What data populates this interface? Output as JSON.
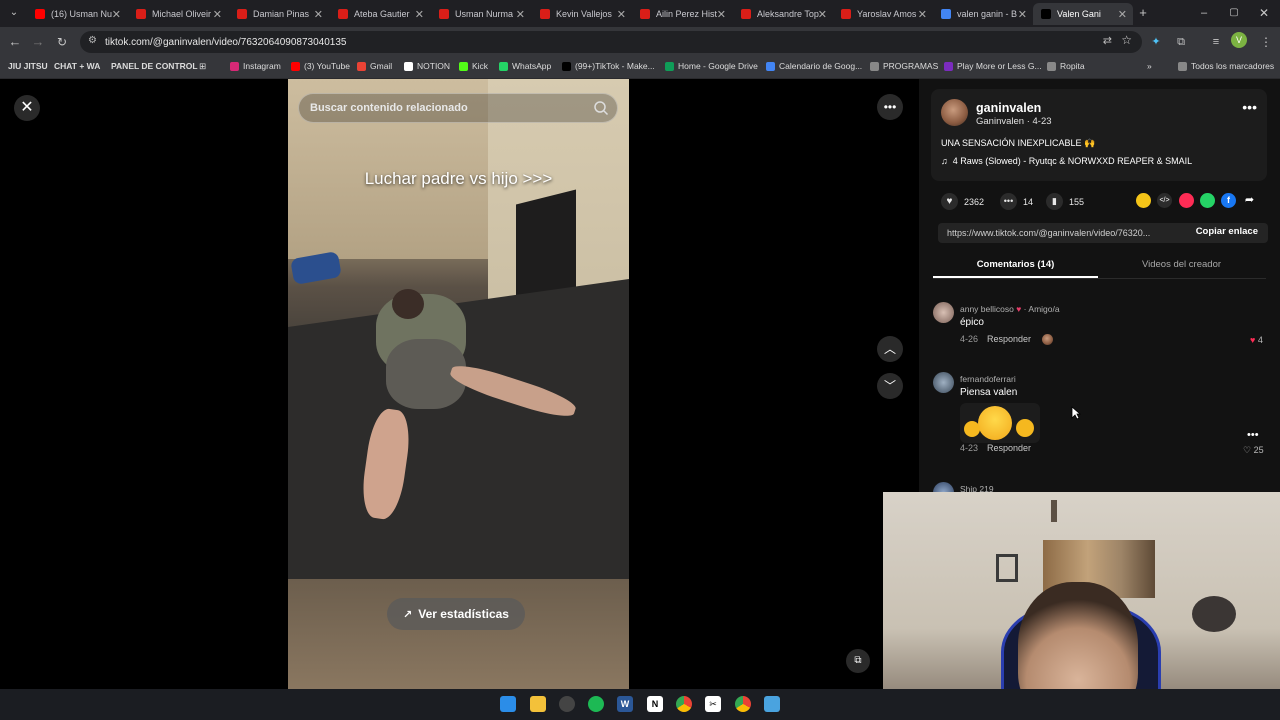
{
  "browser": {
    "tabs": [
      {
        "label": "(16) Usman Nu",
        "color": "#ff0000"
      },
      {
        "label": "Michael Oliveir",
        "color": "#d91e18"
      },
      {
        "label": "Damian Pinas",
        "color": "#d91e18"
      },
      {
        "label": "Ateba Gautier",
        "color": "#d91e18"
      },
      {
        "label": "Usman Nurma",
        "color": "#d91e18"
      },
      {
        "label": "Kevin Vallejos",
        "color": "#d91e18"
      },
      {
        "label": "Ailin Perez Hist",
        "color": "#d91e18"
      },
      {
        "label": "Aleksandre Top",
        "color": "#d91e18"
      },
      {
        "label": "Yaroslav Amos",
        "color": "#d91e18"
      },
      {
        "label": "valen ganin - B",
        "color": "#4285f4"
      },
      {
        "label": "Valen Gani",
        "color": "#000000"
      }
    ],
    "url": "tiktok.com/@ganinvalen/video/7632064090873040135",
    "bookmarks": [
      {
        "label": "JIU JITSU",
        "bold": true
      },
      {
        "label": "CHAT + WA",
        "bold": true
      },
      {
        "label": "PANEL DE CONTROL",
        "bold": true
      },
      {
        "label": "Instagram"
      },
      {
        "label": "(3) YouTube"
      },
      {
        "label": "Gmail"
      },
      {
        "label": "NOTION"
      },
      {
        "label": "Kick"
      },
      {
        "label": "WhatsApp"
      },
      {
        "label": "(99+)TikTok - Make..."
      },
      {
        "label": "Home - Google Drive"
      },
      {
        "label": "Calendario de Goog..."
      },
      {
        "label": "PROGRAMAS"
      },
      {
        "label": "Play More or Less G..."
      },
      {
        "label": "Ropita"
      },
      {
        "label": "Todos los marcadores"
      }
    ]
  },
  "video": {
    "search_placeholder": "Buscar contenido relacionado",
    "caption": "Luchar padre vs hijo >>>",
    "stats_label": "Ver estadísticas"
  },
  "creator": {
    "username": "ganinvalen",
    "display_name": "Ganinvalen",
    "date": "4-23",
    "description": "UNA SENSACIÓN INEXPLICABLE 🙌",
    "music": "4 Raws (Slowed) - Ryutqc & NORWXXD REAPER & SMAIL"
  },
  "stats": {
    "likes": "2362",
    "comments": "14",
    "saves": "155"
  },
  "share": {
    "link": "https://www.tiktok.com/@ganinvalen/video/76320...",
    "copy_label": "Copiar enlace"
  },
  "tabs": {
    "comments": "Comentarios (14)",
    "creator_videos": "Videos del creador"
  },
  "comments": [
    {
      "user": "anny bellicoso",
      "badge": "· Amigo/a",
      "text": "épico",
      "date": "4-26",
      "reply": "Responder",
      "likes": "4"
    },
    {
      "user": "fernandoferrari",
      "text": "Piensa valen",
      "date": "4-23",
      "reply": "Responder",
      "likes": "25"
    },
    {
      "user": "Ship 219"
    }
  ]
}
